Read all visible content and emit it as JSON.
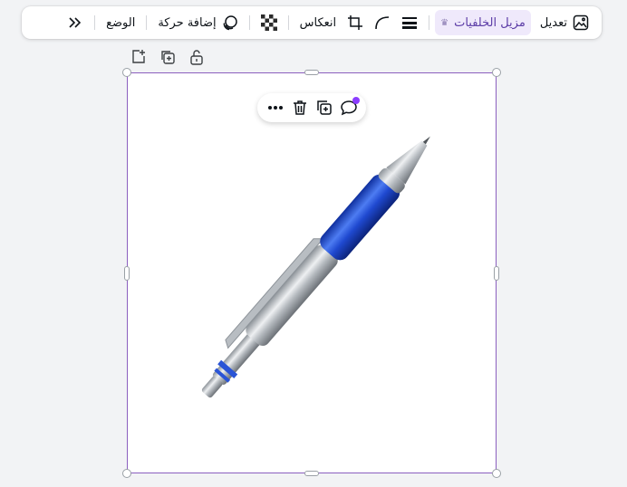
{
  "toolbar": {
    "edit_label": "تعديل",
    "bg_remover_label": "مزيل الخلفيات",
    "flip_label": "انعكاس",
    "animate_label": "إضافة حركة",
    "position_label": "الوضع"
  },
  "icons": {
    "edit": "image-edit-icon",
    "bg_remover_badge": "crown-icon",
    "border": "border-weight-icon",
    "corner": "corner-rounding-icon",
    "crop": "crop-icon",
    "transparency": "transparency-checker-icon",
    "animate": "animate-icon",
    "more": "double-chevron-icon"
  },
  "colors": {
    "selection": "#8b5fbf",
    "active_bg": "#efe9fb",
    "active_text": "#5b3ba6",
    "notification_dot": "#8b3dff",
    "pen_body": "#2a54d6"
  }
}
